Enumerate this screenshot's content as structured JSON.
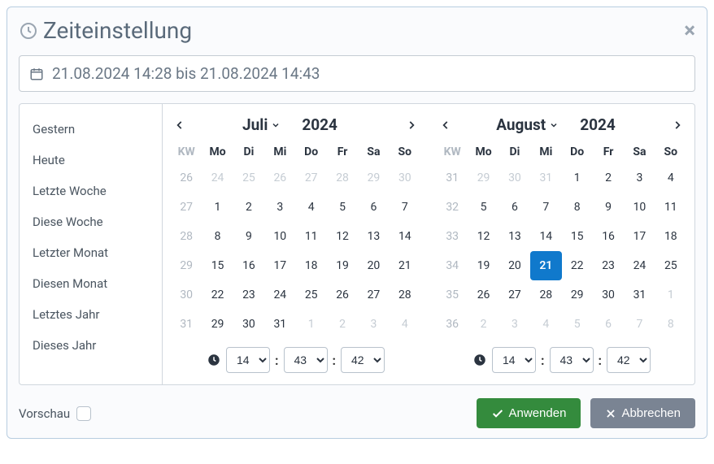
{
  "header": {
    "title": "Zeiteinstellung"
  },
  "range": {
    "text": "21.08.2024 14:28 bis 21.08.2024 14:43"
  },
  "presets": [
    "Gestern",
    "Heute",
    "Letzte Woche",
    "Diese Woche",
    "Letzter Monat",
    "Diesen Monat",
    "Letztes Jahr",
    "Dieses Jahr"
  ],
  "weekday_header": [
    "KW",
    "Mo",
    "Di",
    "Mi",
    "Do",
    "Fr",
    "Sa",
    "So"
  ],
  "left": {
    "month": "Juli",
    "year": "2024",
    "time": {
      "h": "14",
      "m": "43",
      "s": "42"
    },
    "weeks": [
      {
        "wk": "26",
        "days": [
          {
            "d": "24",
            "other": true
          },
          {
            "d": "25",
            "other": true
          },
          {
            "d": "26",
            "other": true
          },
          {
            "d": "27",
            "other": true
          },
          {
            "d": "28",
            "other": true
          },
          {
            "d": "29",
            "other": true
          },
          {
            "d": "30",
            "other": true
          }
        ]
      },
      {
        "wk": "27",
        "days": [
          {
            "d": "1"
          },
          {
            "d": "2"
          },
          {
            "d": "3"
          },
          {
            "d": "4"
          },
          {
            "d": "5"
          },
          {
            "d": "6"
          },
          {
            "d": "7"
          }
        ]
      },
      {
        "wk": "28",
        "days": [
          {
            "d": "8"
          },
          {
            "d": "9"
          },
          {
            "d": "10"
          },
          {
            "d": "11"
          },
          {
            "d": "12"
          },
          {
            "d": "13"
          },
          {
            "d": "14"
          }
        ]
      },
      {
        "wk": "29",
        "days": [
          {
            "d": "15"
          },
          {
            "d": "16"
          },
          {
            "d": "17"
          },
          {
            "d": "18"
          },
          {
            "d": "19"
          },
          {
            "d": "20"
          },
          {
            "d": "21"
          }
        ]
      },
      {
        "wk": "30",
        "days": [
          {
            "d": "22"
          },
          {
            "d": "23"
          },
          {
            "d": "24"
          },
          {
            "d": "25"
          },
          {
            "d": "26"
          },
          {
            "d": "27"
          },
          {
            "d": "28"
          }
        ]
      },
      {
        "wk": "31",
        "days": [
          {
            "d": "29"
          },
          {
            "d": "30"
          },
          {
            "d": "31"
          },
          {
            "d": "1",
            "other": true
          },
          {
            "d": "2",
            "other": true
          },
          {
            "d": "3",
            "other": true
          },
          {
            "d": "4",
            "other": true
          }
        ]
      }
    ]
  },
  "right": {
    "month": "August",
    "year": "2024",
    "selected_day": "21",
    "time": {
      "h": "14",
      "m": "43",
      "s": "42"
    },
    "weeks": [
      {
        "wk": "31",
        "days": [
          {
            "d": "29",
            "other": true
          },
          {
            "d": "30",
            "other": true
          },
          {
            "d": "31",
            "other": true
          },
          {
            "d": "1"
          },
          {
            "d": "2"
          },
          {
            "d": "3"
          },
          {
            "d": "4"
          }
        ]
      },
      {
        "wk": "32",
        "days": [
          {
            "d": "5"
          },
          {
            "d": "6"
          },
          {
            "d": "7"
          },
          {
            "d": "8"
          },
          {
            "d": "9"
          },
          {
            "d": "10"
          },
          {
            "d": "11"
          }
        ]
      },
      {
        "wk": "33",
        "days": [
          {
            "d": "12"
          },
          {
            "d": "13"
          },
          {
            "d": "14"
          },
          {
            "d": "15"
          },
          {
            "d": "16"
          },
          {
            "d": "17"
          },
          {
            "d": "18"
          }
        ]
      },
      {
        "wk": "34",
        "days": [
          {
            "d": "19"
          },
          {
            "d": "20"
          },
          {
            "d": "21",
            "selected": true
          },
          {
            "d": "22"
          },
          {
            "d": "23"
          },
          {
            "d": "24"
          },
          {
            "d": "25"
          }
        ]
      },
      {
        "wk": "35",
        "days": [
          {
            "d": "26"
          },
          {
            "d": "27"
          },
          {
            "d": "28"
          },
          {
            "d": "29"
          },
          {
            "d": "30"
          },
          {
            "d": "31"
          },
          {
            "d": "1",
            "other": true
          }
        ]
      },
      {
        "wk": "36",
        "days": [
          {
            "d": "2",
            "other": true
          },
          {
            "d": "3",
            "other": true
          },
          {
            "d": "4",
            "other": true
          },
          {
            "d": "5",
            "other": true
          },
          {
            "d": "6",
            "other": true
          },
          {
            "d": "7",
            "other": true
          },
          {
            "d": "8",
            "other": true
          }
        ]
      }
    ]
  },
  "footer": {
    "preview_label": "Vorschau",
    "apply_label": "Anwenden",
    "cancel_label": "Abbrechen"
  }
}
